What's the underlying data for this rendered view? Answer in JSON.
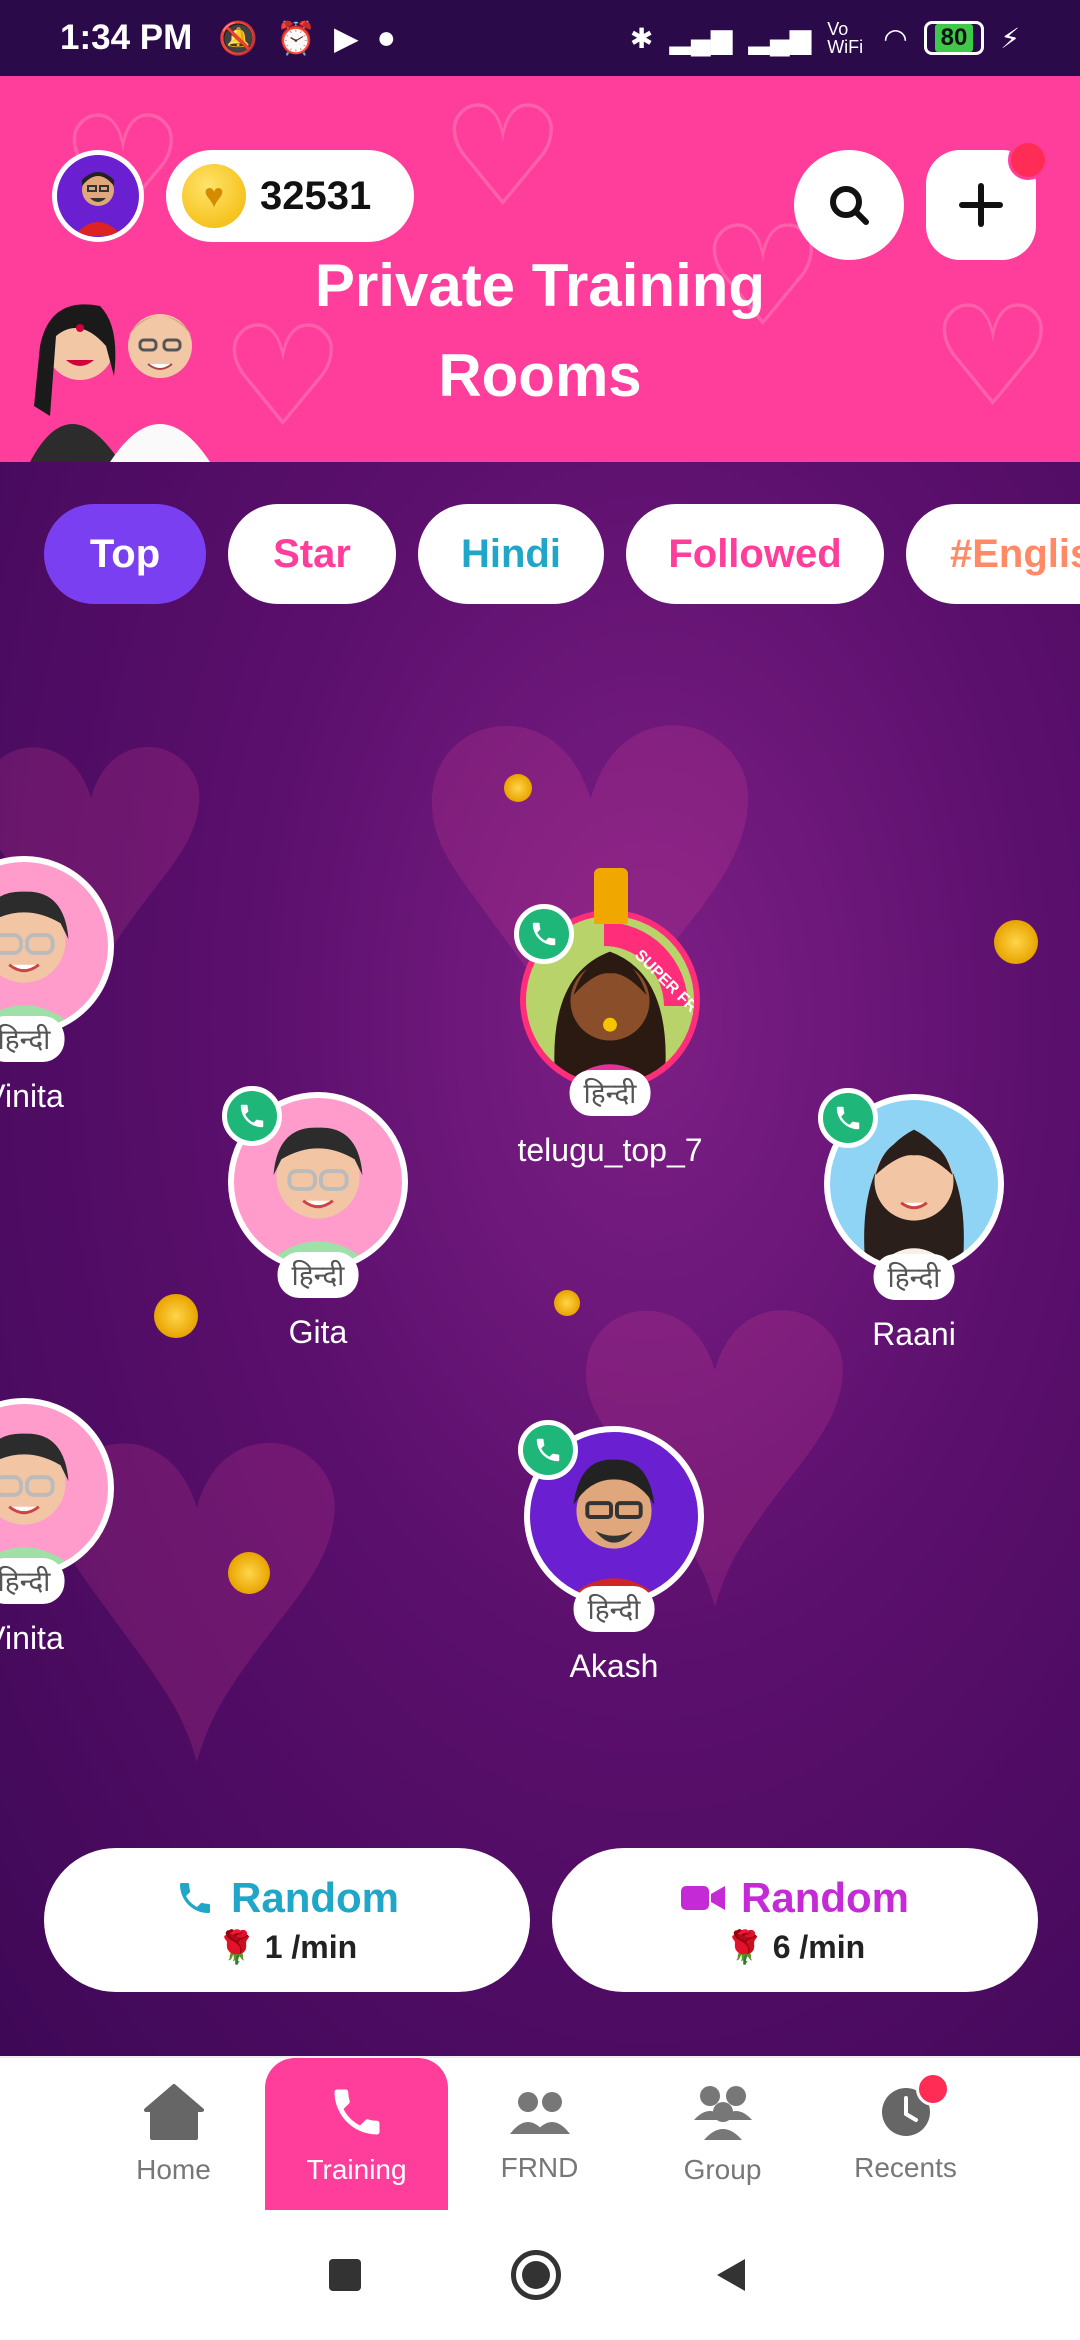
{
  "status_bar": {
    "time": "1:34 PM",
    "battery": "80",
    "wifi_label": "Vo WiFi"
  },
  "header": {
    "coins": "32531",
    "title_line1": "Private Training",
    "title_line2": "Rooms"
  },
  "tabs": [
    {
      "label": "Top",
      "color": "#ffffff"
    },
    {
      "label": "Star",
      "color": "#ff3d9a"
    },
    {
      "label": "Hindi",
      "color": "#1fa6c9"
    },
    {
      "label": "Followed",
      "color": "#ff3d9a"
    },
    {
      "label": "#Englis",
      "color": "#ff8a65"
    }
  ],
  "profiles": [
    {
      "name": "Vinita",
      "lang": "हिन्दी"
    },
    {
      "name": "telugu_top_7",
      "lang": "हिन्दी",
      "badge": "SUPER FRND"
    },
    {
      "name": "Gita",
      "lang": "हिन्दी"
    },
    {
      "name": "Raani",
      "lang": "हिन्दी"
    },
    {
      "name": "Vinita",
      "lang": "हिन्दी"
    },
    {
      "name": "Akash",
      "lang": "हिन्दी"
    }
  ],
  "random_buttons": {
    "audio": {
      "label": "Random",
      "price": "1 /min",
      "color": "#1fa6c9"
    },
    "video": {
      "label": "Random",
      "price": "6 /min",
      "color": "#c42bd6"
    }
  },
  "bottom_nav": [
    {
      "label": "Home"
    },
    {
      "label": "Training"
    },
    {
      "label": "FRND"
    },
    {
      "label": "Group"
    },
    {
      "label": "Recents"
    }
  ],
  "colors": {
    "brand_pink": "#ff3d9a",
    "accent_purple": "#7b3ff2",
    "call_green": "#1fb67a"
  }
}
